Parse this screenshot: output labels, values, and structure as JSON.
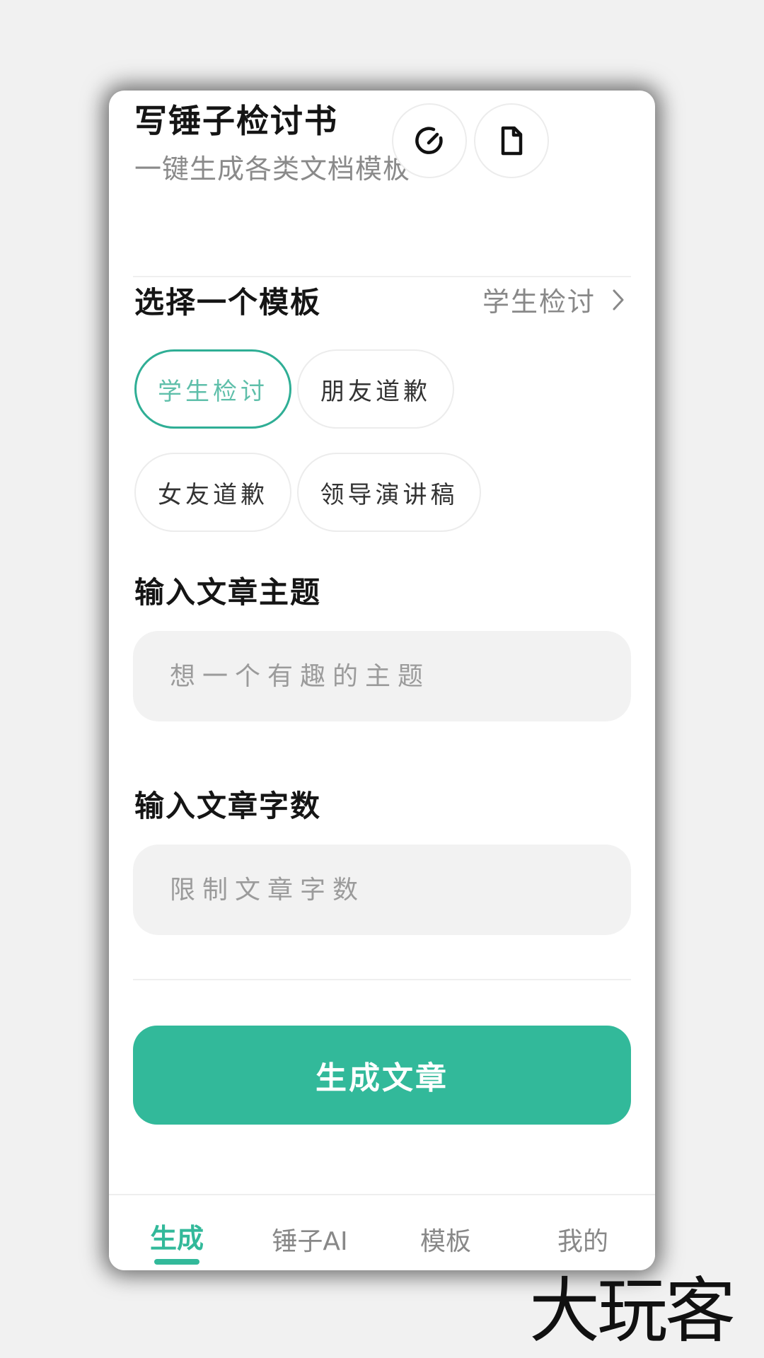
{
  "header": {
    "title": "写锤子检讨书",
    "subtitle": "一键生成各类文档模板",
    "history_icon": "history-check-icon",
    "document_icon": "document-icon"
  },
  "template_section": {
    "title": "选择一个模板",
    "selected": "学生检讨",
    "options": [
      "学生检讨",
      "朋友道歉",
      "女友道歉",
      "领导演讲稿"
    ],
    "active_index": 0
  },
  "topic_section": {
    "title": "输入文章主题",
    "placeholder": "想一个有趣的主题",
    "value": ""
  },
  "wordcount_section": {
    "title": "输入文章字数",
    "placeholder": "限制文章字数",
    "value": ""
  },
  "generate_button": {
    "label": "生成文章"
  },
  "tabbar": {
    "items": [
      "生成",
      "锤子AI",
      "模板",
      "我的"
    ],
    "active_index": 0
  },
  "watermark": {
    "text": "大玩客"
  },
  "colors": {
    "accent": "#32b99a",
    "accent_light": "#5fbfaa",
    "input_bg": "#f2f2f2"
  }
}
